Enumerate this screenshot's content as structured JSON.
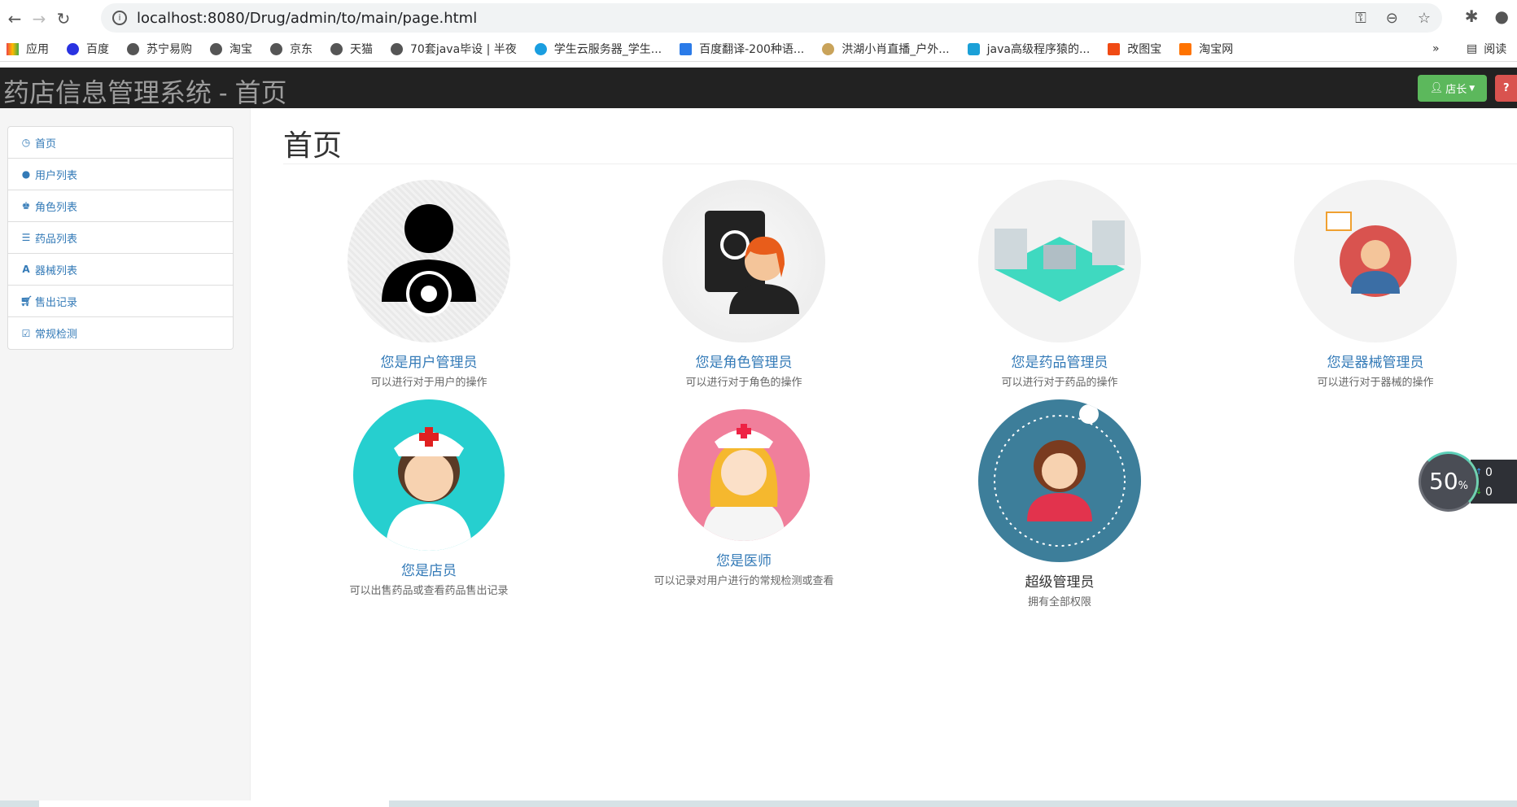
{
  "browser": {
    "url": "localhost:8080/Drug/admin/to/main/page.html",
    "bookmarks": [
      "应用",
      "百度",
      "苏宁易购",
      "淘宝",
      "京东",
      "天猫",
      "70套java毕设 | 半夜",
      "学生云服务器_学生...",
      "百度翻译-200种语...",
      "洪湖小肖直播_户外...",
      "java高级程序猿的...",
      "改图宝",
      "淘宝网"
    ],
    "more": "»",
    "reading_list": "阅读"
  },
  "header": {
    "title": "药店信息管理系统 - 首页",
    "user_button": "店长",
    "help_icon": "question-circle-icon",
    "brand_color": "#222222",
    "user_color": "#5cb85c",
    "help_color": "#d9534f"
  },
  "sidebar": {
    "items": [
      {
        "label": "首页",
        "icon": "dashboard-icon"
      },
      {
        "label": "用户列表",
        "icon": "user-icon"
      },
      {
        "label": "角色列表",
        "icon": "king-icon"
      },
      {
        "label": "药品列表",
        "icon": "list-icon"
      },
      {
        "label": "器械列表",
        "icon": "road-icon"
      },
      {
        "label": "售出记录",
        "icon": "cart-icon"
      },
      {
        "label": "常规检测",
        "icon": "edit-icon"
      }
    ]
  },
  "main": {
    "title": "首页",
    "cards": [
      {
        "title": "您是用户管理员",
        "desc": "可以进行对于用户的操作"
      },
      {
        "title": "您是角色管理员",
        "desc": "可以进行对于角色的操作"
      },
      {
        "title": "您是药品管理员",
        "desc": "可以进行对于药品的操作"
      },
      {
        "title": "您是器械管理员",
        "desc": "可以进行对于器械的操作"
      },
      {
        "title": "您是店员",
        "desc": "可以出售药品或查看药品售出记录"
      },
      {
        "title": "您是医师",
        "desc": "可以记录对用户进行的常规检测或查看"
      },
      {
        "title": "超级管理员",
        "desc": "拥有全部权限"
      }
    ]
  },
  "widget": {
    "percent": "50",
    "unit": "%",
    "up": "0",
    "down": "0"
  }
}
